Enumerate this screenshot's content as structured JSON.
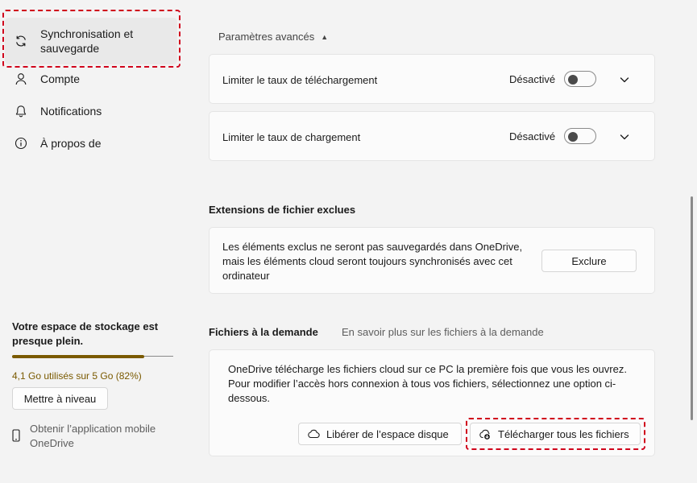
{
  "sidebar": {
    "items": [
      {
        "label": "Synchronisation et sauvegarde",
        "icon": "sync-icon"
      },
      {
        "label": "Compte",
        "icon": "person-icon"
      },
      {
        "label": "Notifications",
        "icon": "bell-icon"
      },
      {
        "label": "À propos de",
        "icon": "info-icon"
      }
    ],
    "storage": {
      "title": "Votre espace de stockage est presque plein.",
      "usage_text": "4,1 Go utilisés sur 5 Go (82%)",
      "used_fraction": 0.82,
      "upgrade_label": "Mettre à niveau",
      "mobile_app_label": "Obtenir l’application mobile OneDrive"
    }
  },
  "advanced": {
    "toggle_label": "Paramètres avancés",
    "rows": [
      {
        "label": "Limiter le taux de téléchargement",
        "state": "Désactivé"
      },
      {
        "label": "Limiter le taux de chargement",
        "state": "Désactivé"
      }
    ]
  },
  "excluded": {
    "heading": "Extensions de fichier exclues",
    "description": "Les éléments exclus ne seront pas sauvegardés dans OneDrive, mais les éléments cloud seront toujours synchronisés avec cet ordinateur",
    "button_label": "Exclure"
  },
  "files_on_demand": {
    "heading": "Fichiers à la demande",
    "learn_more": "En savoir plus sur les fichiers à la demande",
    "description": "OneDrive télécharge les fichiers cloud sur ce PC la première fois que vous les ouvrez. Pour modifier l’accès hors connexion à tous vos fichiers, sélectionnez une option ci-dessous.",
    "free_space_label": "Libérer de l’espace disque",
    "download_all_label": "Télécharger tous les fichiers"
  },
  "colors": {
    "highlight": "#d0021b",
    "storage_warning": "#7a5a00",
    "background": "#f3f3f3"
  }
}
